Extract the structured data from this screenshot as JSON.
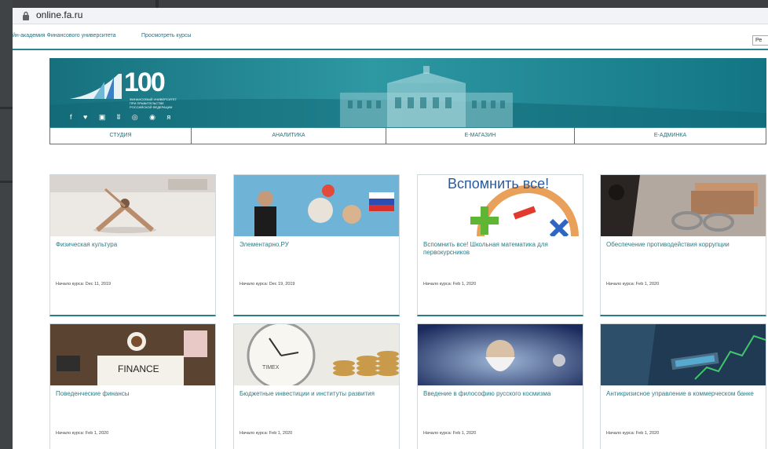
{
  "browser": {
    "url": "online.fa.ru"
  },
  "nav": {
    "academy_link": "йн-академия Финансового университета",
    "courses_link": "Просмотреть курсы",
    "register_button": "Ре"
  },
  "banner": {
    "logo_number": "100",
    "logo_lines": [
      "ФИНАНСОВЫЙ УНИВЕРСИТЕТ",
      "ПРИ ПРАВИТЕЛЬСТВЕ",
      "РОССИЙСКОЙ ФЕДЕРАЦИИ"
    ],
    "social_icons": "f ♥ ▣ ʬ ◎ ◉ я"
  },
  "tabs": [
    "СТУДИЯ",
    "АНАЛИТИКА",
    "Е-МАГАЗИН",
    "Е-АДМИНКА"
  ],
  "cards": [
    {
      "title": "Физическая культура",
      "date": "Начало курса: Dec 11, 2019"
    },
    {
      "title": "Элементарно.РУ",
      "date": "Начало курса: Dec 19, 2019"
    },
    {
      "title": "Вспомнить все! Школьная математика для первокурсников",
      "date": "Начало курса: Feb 1, 2020",
      "image_caption": "Вспомнить все!"
    },
    {
      "title": "Обеспечение противодействия коррупции",
      "date": "Начало курса: Feb 1, 2020"
    },
    {
      "title": "Поведенческие финансы",
      "date": "Начало курса: Feb 1, 2020",
      "image_caption": "FINANCE"
    },
    {
      "title": "Бюджетные инвестиции и институты развития",
      "date": "Начало курса: Feb 1, 2020",
      "image_caption": "TIMEX"
    },
    {
      "title": "Введение в философию русского космизма",
      "date": "Начало курса: Feb 1, 2020"
    },
    {
      "title": "Антикризисное управление в коммерческом банке",
      "date": "Начало курса: Feb 1, 2020"
    }
  ],
  "colors": {
    "accent": "#2a7d88",
    "banner": "#1a7f8c",
    "frame": "#3f4346"
  }
}
